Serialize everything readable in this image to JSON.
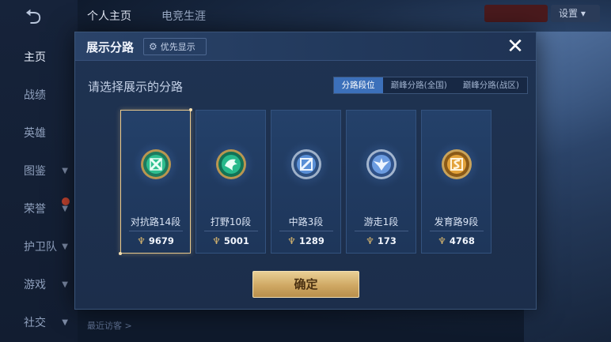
{
  "background": {
    "top_tabs": [
      "个人主页",
      "电竞生涯"
    ],
    "settings_label": "设置",
    "sidebar": [
      {
        "label": "主页",
        "active": true
      },
      {
        "label": "战绩"
      },
      {
        "label": "英雄"
      },
      {
        "label": "图鉴",
        "chevron": true
      },
      {
        "label": "荣誉",
        "chevron": true,
        "badge": true
      },
      {
        "label": "护卫队",
        "chevron": true
      },
      {
        "label": "游戏",
        "chevron": true
      },
      {
        "label": "社交",
        "chevron": true
      }
    ],
    "recent_visitors": "最近访客 >"
  },
  "modal": {
    "title": "展示分路",
    "priority_button": "优先显示",
    "close_icon": "close-icon",
    "subtitle": "请选择展示的分路",
    "tabs": [
      {
        "label": "分路段位",
        "active": true
      },
      {
        "label": "巅峰分路(全国)",
        "active": false
      },
      {
        "label": "巅峰分路(战区)",
        "active": false
      }
    ],
    "cards": [
      {
        "label": "对抗路14段",
        "score": "9679",
        "selected": true,
        "icon": "clash-lane-emblem",
        "color": "#2fbf8f"
      },
      {
        "label": "打野10段",
        "score": "5001",
        "selected": false,
        "icon": "jungle-dragon-emblem",
        "color": "#27b98b"
      },
      {
        "label": "中路3段",
        "score": "1289",
        "selected": false,
        "icon": "mid-lane-emblem",
        "color": "#5a8fd6"
      },
      {
        "label": "游走1段",
        "score": "173",
        "selected": false,
        "icon": "roam-wings-emblem",
        "color": "#6b9be0"
      },
      {
        "label": "发育路9段",
        "score": "4768",
        "selected": false,
        "icon": "farm-lane-emblem",
        "color": "#e2a23a"
      }
    ],
    "confirm_button": "确定"
  },
  "colors": {
    "accent_gold": "#d8b66e",
    "tab_active": "#3c70ba"
  }
}
